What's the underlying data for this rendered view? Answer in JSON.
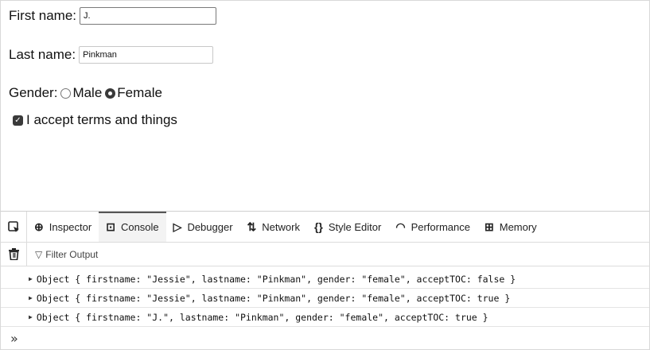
{
  "form": {
    "first_name_label": "First name:",
    "first_name_value": "J.",
    "last_name_label": "Last name:",
    "last_name_value": "Pinkman",
    "gender_label": "Gender:",
    "gender_options": [
      "Male",
      "Female"
    ],
    "gender_selected": "Female",
    "terms_label": "I accept terms and things",
    "terms_checked": true
  },
  "devtools": {
    "tabs": [
      {
        "label": "Inspector",
        "icon": "inspector-icon"
      },
      {
        "label": "Console",
        "icon": "console-icon",
        "active": true
      },
      {
        "label": "Debugger",
        "icon": "debugger-icon"
      },
      {
        "label": "Network",
        "icon": "network-icon"
      },
      {
        "label": "Style Editor",
        "icon": "style-editor-icon"
      },
      {
        "label": "Performance",
        "icon": "performance-icon"
      },
      {
        "label": "Memory",
        "icon": "memory-icon"
      }
    ],
    "filter_placeholder": "Filter Output",
    "logs": [
      "Object { firstname: \"Jessie\", lastname: \"Pinkman\", gender: \"female\", acceptTOC: false }",
      "Object { firstname: \"Jessie\", lastname: \"Pinkman\", gender: \"female\", acceptTOC: true }",
      "Object { firstname: \"J.\", lastname: \"Pinkman\", gender: \"female\", acceptTOC: true }"
    ],
    "prompt_symbol": "»"
  }
}
